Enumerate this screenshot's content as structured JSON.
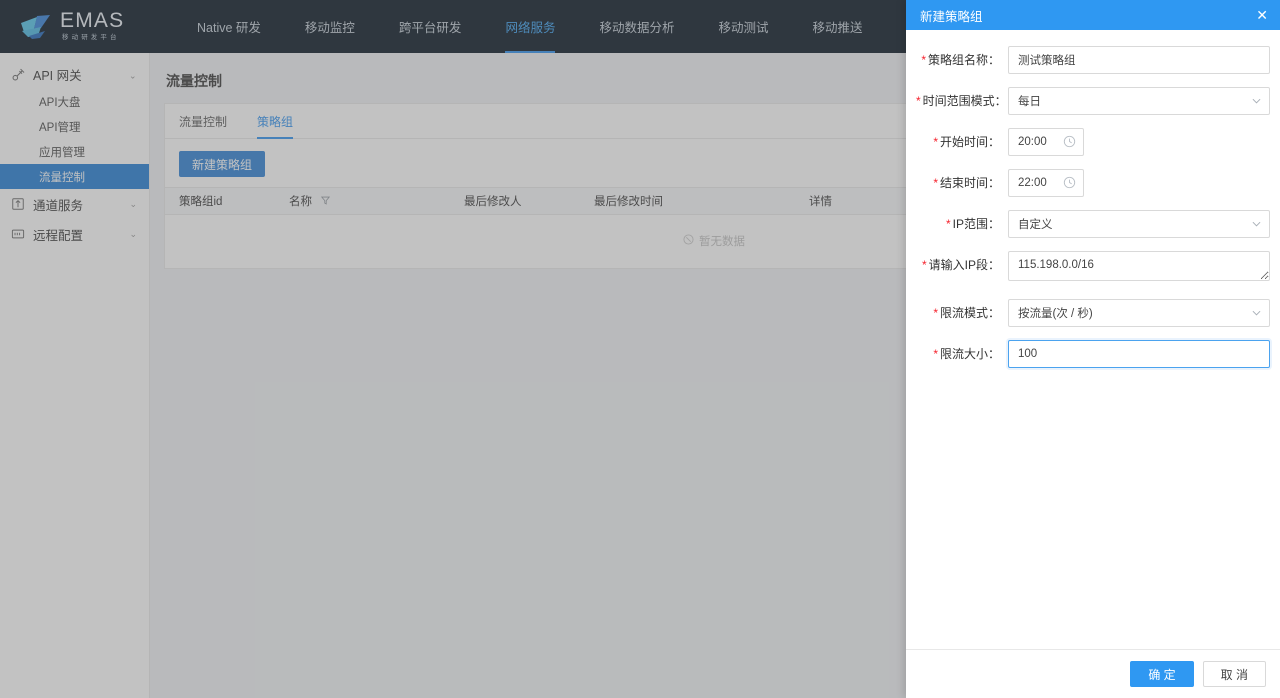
{
  "brand": {
    "name": "EMAS",
    "tagline": "移动研发平台",
    "logo_icon": "emas-boat-logo",
    "accent": "#2a8ff0"
  },
  "topnav": {
    "items": [
      {
        "label": "Native 研发",
        "active": false
      },
      {
        "label": "移动监控",
        "active": false
      },
      {
        "label": "跨平台研发",
        "active": false
      },
      {
        "label": "网络服务",
        "active": true
      },
      {
        "label": "移动数据分析",
        "active": false
      },
      {
        "label": "移动测试",
        "active": false
      },
      {
        "label": "移动推送",
        "active": false
      }
    ]
  },
  "sidebar": {
    "groups": [
      {
        "label": "API 网关",
        "icon": "api-gateway-icon",
        "expanded": true,
        "caret": "⌃",
        "children": [
          {
            "label": "API大盘",
            "active": false
          },
          {
            "label": "API管理",
            "active": false
          },
          {
            "label": "应用管理",
            "active": false
          },
          {
            "label": "流量控制",
            "active": true
          }
        ]
      },
      {
        "label": "通道服务",
        "icon": "channel-service-icon",
        "expanded": false,
        "caret": "⌄",
        "children": []
      },
      {
        "label": "远程配置",
        "icon": "remote-config-icon",
        "expanded": false,
        "caret": "⌄",
        "children": []
      }
    ]
  },
  "main": {
    "page_title": "流量控制",
    "tabs": [
      {
        "label": "流量控制",
        "active": false
      },
      {
        "label": "策略组",
        "active": true
      }
    ],
    "create_button": "新建策略组",
    "table": {
      "columns": [
        {
          "label": "策略组id",
          "filter": false
        },
        {
          "label": "名称",
          "filter": true,
          "filter_icon": "filter-funnel-icon"
        },
        {
          "label": "最后修改人",
          "filter": false
        },
        {
          "label": "最后修改时间",
          "filter": false
        },
        {
          "label": "详情",
          "filter": false
        }
      ],
      "rows": [],
      "empty_text": "暂无数据",
      "empty_icon": "no-data-icon"
    }
  },
  "modal": {
    "title": "新建策略组",
    "close_icon": "close-icon",
    "fields": {
      "group_name": {
        "label": "策略组名称：",
        "required": true,
        "value": "测试策略组",
        "placeholder": ""
      },
      "time_range_mode": {
        "label": "时间范围模式：",
        "required": true,
        "value": "每日",
        "caret_icon": "chevron-down-icon",
        "options": [
          "每日"
        ]
      },
      "start_time": {
        "label": "开始时间：",
        "required": true,
        "value": "20:00",
        "icon": "clock-icon"
      },
      "end_time": {
        "label": "结束时间：",
        "required": true,
        "value": "22:00",
        "icon": "clock-icon"
      },
      "ip_range": {
        "label": "IP范围：",
        "required": true,
        "value": "自定义",
        "caret_icon": "chevron-down-icon",
        "options": [
          "自定义"
        ]
      },
      "ip_segment": {
        "label": "请输入IP段：",
        "required": true,
        "value": "115.198.0.0/16",
        "resize_handle": "resize-grip-icon"
      },
      "limit_mode": {
        "label": "限流模式：",
        "required": true,
        "value": "按流量(次 / 秒)",
        "caret_icon": "chevron-down-icon",
        "options": [
          "按流量(次 / 秒)"
        ]
      },
      "limit_size": {
        "label": "限流大小：",
        "required": true,
        "value": "100",
        "focused": true
      }
    },
    "footer": {
      "confirm": "确 定",
      "cancel": "取 消"
    }
  }
}
